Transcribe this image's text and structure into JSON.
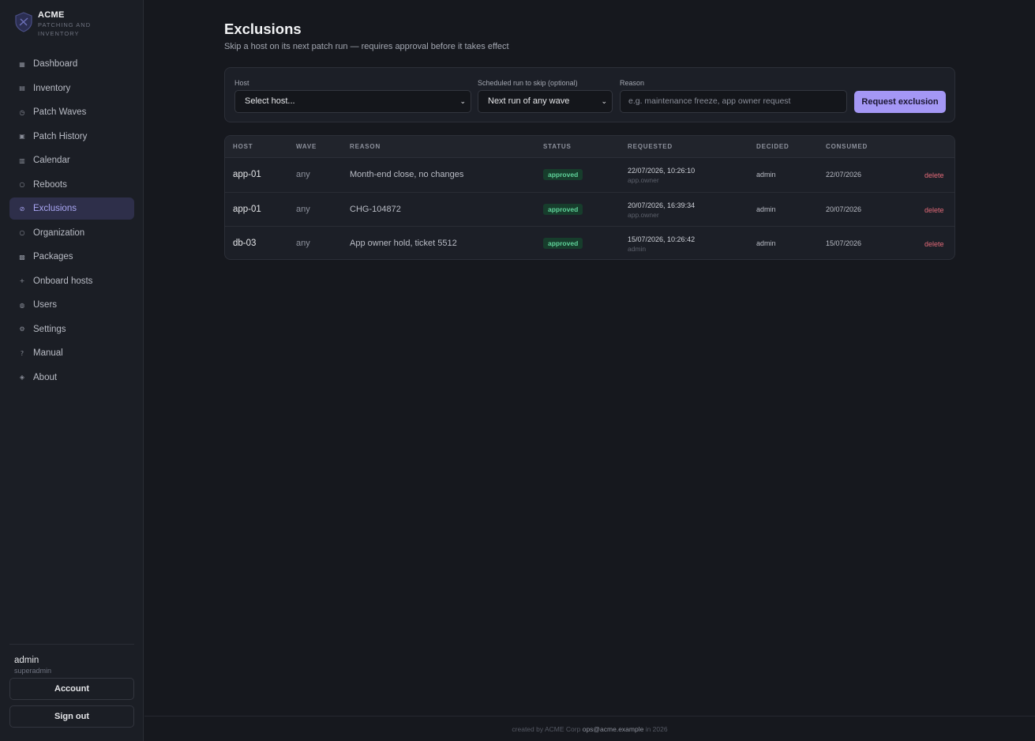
{
  "brand": {
    "name": "ACME",
    "subtitle": "PATCHING AND INVENTORY"
  },
  "nav": [
    {
      "label": "Dashboard",
      "icon": "grid-icon",
      "glyph": "▦",
      "active": false
    },
    {
      "label": "Inventory",
      "icon": "list-icon",
      "glyph": "▤",
      "active": false
    },
    {
      "label": "Patch Waves",
      "icon": "clock-icon",
      "glyph": "◷",
      "active": false
    },
    {
      "label": "Patch History",
      "icon": "history-icon",
      "glyph": "▣",
      "active": false
    },
    {
      "label": "Calendar",
      "icon": "calendar-icon",
      "glyph": "▥",
      "active": false
    },
    {
      "label": "Reboots",
      "icon": "reboot-icon",
      "glyph": "○",
      "active": false
    },
    {
      "label": "Exclusions",
      "icon": "exclusion-icon",
      "glyph": "⊘",
      "active": true
    },
    {
      "label": "Organization",
      "icon": "organization-icon",
      "glyph": "○",
      "active": false
    },
    {
      "label": "Packages",
      "icon": "package-icon",
      "glyph": "▩",
      "active": false
    },
    {
      "label": "Onboard hosts",
      "icon": "plus-icon",
      "glyph": "+",
      "active": false
    },
    {
      "label": "Users",
      "icon": "users-icon",
      "glyph": "◍",
      "active": false
    },
    {
      "label": "Settings",
      "icon": "gear-icon",
      "glyph": "⚙",
      "active": false
    },
    {
      "label": "Manual",
      "icon": "help-icon",
      "glyph": "?",
      "active": false
    },
    {
      "label": "About",
      "icon": "info-icon",
      "glyph": "◈",
      "active": false
    }
  ],
  "user": {
    "name": "admin",
    "role": "superadmin",
    "account_label": "Account",
    "signout_label": "Sign out"
  },
  "page": {
    "title": "Exclusions",
    "subtitle": "Skip a host on its next patch run — requires approval before it takes effect"
  },
  "form": {
    "host_label": "Host",
    "host_value": "Select host...",
    "run_label": "Scheduled run to skip (optional)",
    "run_value": "Next run of any wave",
    "reason_label": "Reason",
    "reason_placeholder": "e.g. maintenance freeze, app owner request",
    "submit_label": "Request exclusion"
  },
  "table": {
    "headers": [
      "HOST",
      "WAVE",
      "REASON",
      "STATUS",
      "REQUESTED",
      "DECIDED",
      "CONSUMED"
    ],
    "rows": [
      {
        "host": "app-01",
        "wave": "any",
        "reason": "Month-end close, no changes",
        "status": "approved",
        "requested": "22/07/2026, 10:26:10",
        "requested_by": "app.owner",
        "decided": "admin",
        "consumed": "22/07/2026",
        "action": "delete"
      },
      {
        "host": "app-01",
        "wave": "any",
        "reason": "CHG-104872",
        "status": "approved",
        "requested": "20/07/2026, 16:39:34",
        "requested_by": "app.owner",
        "decided": "admin",
        "consumed": "20/07/2026",
        "action": "delete"
      },
      {
        "host": "db-03",
        "wave": "any",
        "reason": "App owner hold, ticket 5512",
        "status": "approved",
        "requested": "15/07/2026, 10:26:42",
        "requested_by": "admin",
        "decided": "admin",
        "consumed": "15/07/2026",
        "action": "delete"
      }
    ]
  },
  "footer": {
    "prefix": "created by ACME Corp",
    "email": "ops@acme.example",
    "suffix": "in 2026"
  },
  "colors": {
    "accent": "#a497f5",
    "background": "#16181e",
    "sidebar": "#1b1e25",
    "approved": "#5fd39a",
    "danger": "#e36a78"
  }
}
